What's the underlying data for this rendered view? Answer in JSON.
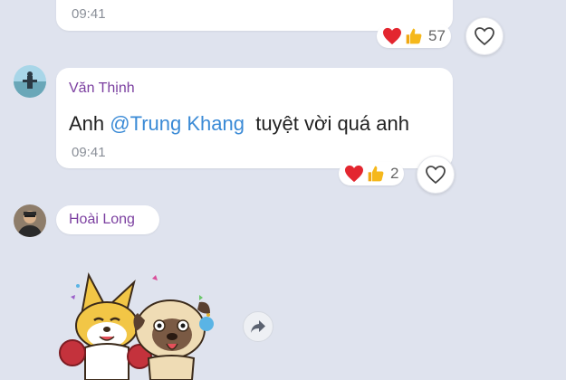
{
  "messages": [
    {
      "time": "09:41",
      "reaction_count": "57"
    },
    {
      "sender": "Văn Thịnh",
      "text_prefix": "Anh ",
      "mention": "@Trung Khang",
      "text_suffix": "  tuyệt vời quá anh",
      "time": "09:41",
      "reaction_count": "2"
    },
    {
      "sender": "Hoài Long",
      "content": "sticker"
    }
  ],
  "colors": {
    "background": "#dfe3ee",
    "sender_name": "#7b3fa0",
    "mention": "#3a8ad6",
    "heart_reaction": "#e3262f",
    "like_reaction": "#f5b81c"
  },
  "icons": [
    "heart-reaction-icon",
    "like-reaction-icon",
    "heart-outline-icon",
    "share-arrow-icon"
  ]
}
